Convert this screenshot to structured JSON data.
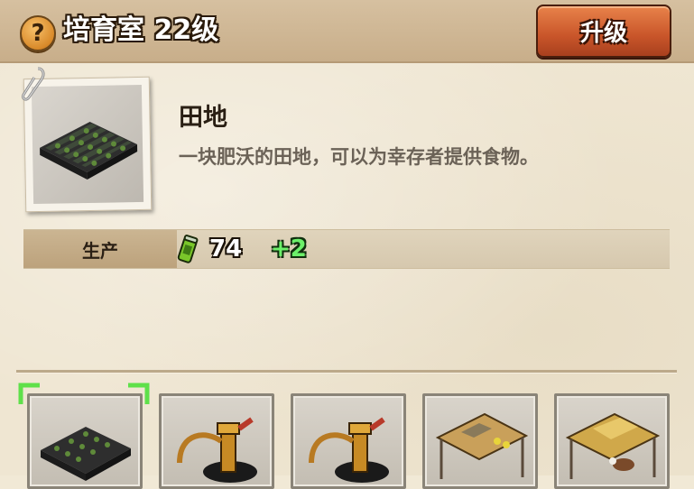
{
  "header": {
    "help_icon": "question-mark-icon",
    "help_label": "?",
    "title": "培育室 22级",
    "upgrade_label": "升级"
  },
  "item": {
    "name": "田地",
    "description": "一块肥沃的田地，可以为幸存者提供食物。"
  },
  "production": {
    "label": "生产",
    "resource_icon": "food-can-icon",
    "value": "74",
    "bonus": "+2"
  },
  "tiles": [
    {
      "name": "field",
      "icon": "field-icon",
      "selected": true
    },
    {
      "name": "water-pump-1",
      "icon": "water-pump-icon",
      "selected": false
    },
    {
      "name": "water-pump-2",
      "icon": "water-pump-icon",
      "selected": false
    },
    {
      "name": "chicken-coop",
      "icon": "coop-icon",
      "selected": false
    },
    {
      "name": "cattle-pen",
      "icon": "cattle-pen-icon",
      "selected": false
    }
  ],
  "colors": {
    "header_bg": "#cfb794",
    "upgrade_btn": "#c9552a",
    "bonus_green": "#6cf06a",
    "select_green": "#5fe04a"
  }
}
